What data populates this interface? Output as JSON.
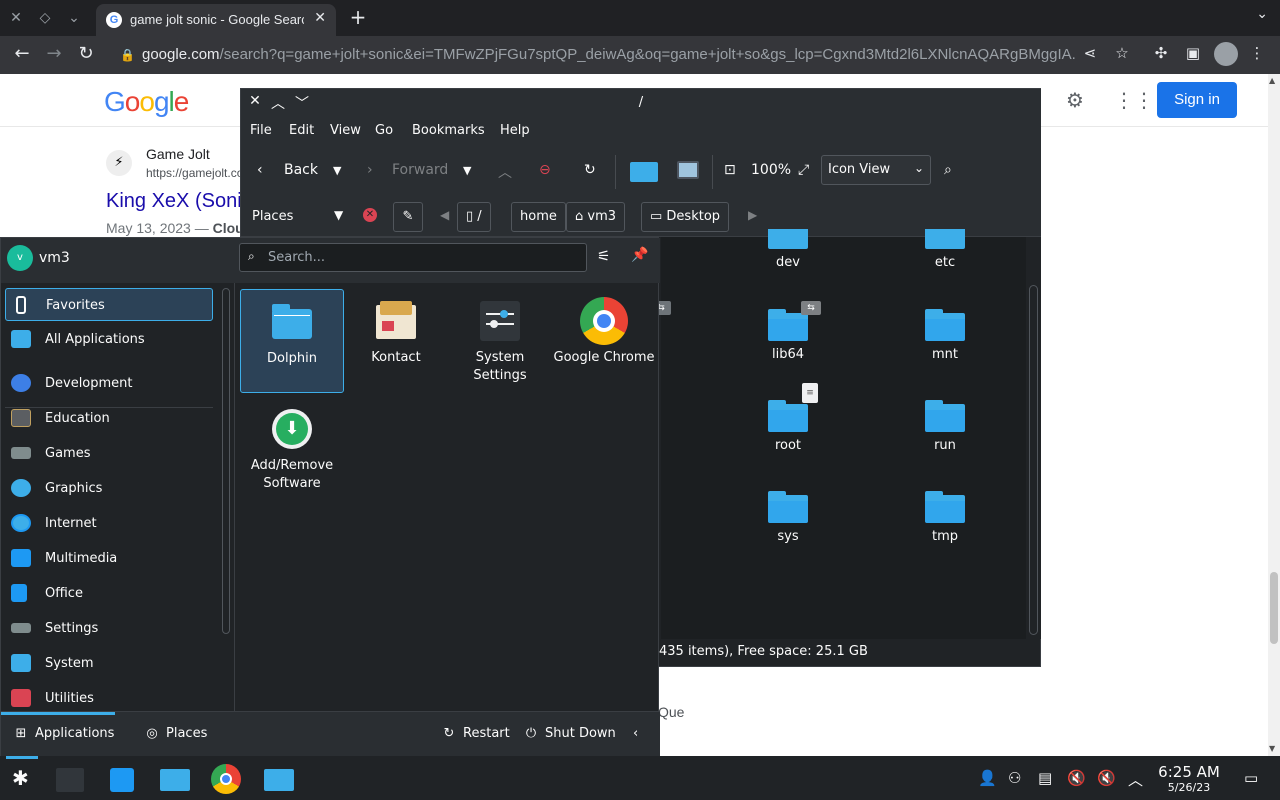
{
  "browser": {
    "tab_title": "game jolt sonic - Google Search",
    "url_host": "google.com",
    "url_rest": "/search?q=game+jolt+sonic&ei=TMFwZPjFGu7sptQP_deiwAg&oq=game+jolt+so&gs_lcp=Cgxnd3Mtd2l6LXNlcnAQARgBMggIA..."
  },
  "google": {
    "sign_in": "Sign in",
    "result_site": "Game Jolt",
    "result_url": "https://gamejolt.com",
    "result_title": "King XeX (Sonic",
    "result_date": "May 13, 2023 — ",
    "result_date_bold": "Cloud",
    "snippet_end": "Que"
  },
  "dolphin": {
    "title": "/",
    "menu": [
      "File",
      "Edit",
      "View",
      "Go",
      "Bookmarks",
      "Help"
    ],
    "back": "Back",
    "forward": "Forward",
    "zoom": "100%",
    "view_mode": "Icon View",
    "places": "Places",
    "crumbs": [
      "/",
      "home",
      "vm3",
      "Desktop"
    ],
    "folders": [
      {
        "name": "dev"
      },
      {
        "name": "etc"
      },
      {
        "name": "lib64"
      },
      {
        "name": "mnt"
      },
      {
        "name": "root"
      },
      {
        "name": "run"
      },
      {
        "name": "sys"
      },
      {
        "name": "tmp"
      }
    ],
    "status": "435 items), Free space: 25.1 GB"
  },
  "kickoff": {
    "user": "vm3",
    "avatar_letter": "v",
    "search_placeholder": "Search...",
    "categories": [
      {
        "label": "Favorites",
        "icon": "bookmark-icon",
        "color": "#2a2e32"
      },
      {
        "label": "All Applications",
        "icon": "grid-icon",
        "color": "#3daee9"
      },
      {
        "label": "Development",
        "icon": "development-icon",
        "color": "#3d7fe6"
      },
      {
        "label": "Education",
        "icon": "education-icon",
        "color": "#5b5e62"
      },
      {
        "label": "Games",
        "icon": "gamepad-icon",
        "color": "#7f8c8d"
      },
      {
        "label": "Graphics",
        "icon": "graphics-icon",
        "color": "#3daee9"
      },
      {
        "label": "Internet",
        "icon": "globe-icon",
        "color": "#3daee9"
      },
      {
        "label": "Multimedia",
        "icon": "multimedia-icon",
        "color": "#1d99f3"
      },
      {
        "label": "Office",
        "icon": "office-icon",
        "color": "#1d99f3"
      },
      {
        "label": "Settings",
        "icon": "settings-icon",
        "color": "#7f8c8d"
      },
      {
        "label": "System",
        "icon": "system-icon",
        "color": "#3daee9"
      },
      {
        "label": "Utilities",
        "icon": "utilities-icon",
        "color": "#da4453"
      }
    ],
    "apps": [
      {
        "label": "Dolphin",
        "icon": "dolphin-folder-icon"
      },
      {
        "label": "Kontact",
        "icon": "kontact-icon"
      },
      {
        "label": "System Settings",
        "icon": "system-settings-icon"
      },
      {
        "label": "Google Chrome",
        "icon": "chrome-icon"
      },
      {
        "label": "Add/Remove Software",
        "icon": "software-install-icon"
      }
    ],
    "footer": {
      "applications": "Applications",
      "places": "Places",
      "restart": "Restart",
      "shutdown": "Shut Down"
    }
  },
  "taskbar": {
    "time": "6:25 AM",
    "date": "5/26/23"
  }
}
